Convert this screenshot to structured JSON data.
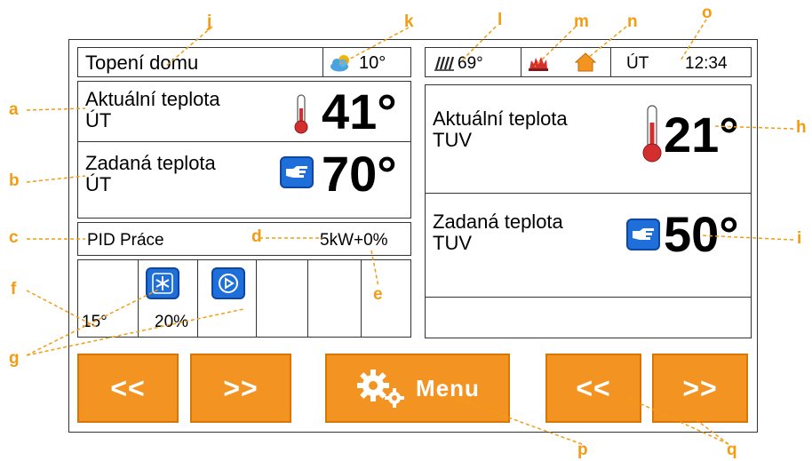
{
  "header": {
    "title": "Topení domu",
    "outdoor_temp": "10°",
    "heat_temp": "69°",
    "day": "ÚT",
    "time": "12:34"
  },
  "heating": {
    "actual_label_1": "Aktuální teplota",
    "actual_label_2": "ÚT",
    "actual_value": "41°",
    "set_label_1": "Zadaná teplota",
    "set_label_2": "ÚT",
    "set_value": "70°"
  },
  "status": {
    "pid_label": "PID Práce",
    "power": "5kW+0%"
  },
  "components": {
    "temp": "15°",
    "fan_value": "20%"
  },
  "hot_water": {
    "actual_label_1": "Aktuální teplota",
    "actual_label_2": "TUV",
    "actual_value": "21°",
    "set_label_1": "Zadaná teplota",
    "set_label_2": "TUV",
    "set_value": "50°"
  },
  "buttons": {
    "prev_left": "<<",
    "next_left": ">>",
    "menu": "Menu",
    "prev_right": "<<",
    "next_right": ">>"
  },
  "callouts": [
    "a",
    "b",
    "c",
    "d",
    "e",
    "f",
    "g",
    "h",
    "i",
    "j",
    "k",
    "l",
    "m",
    "n",
    "o",
    "p",
    "q"
  ],
  "colors": {
    "accent_orange": "#f39422",
    "callout_orange": "#f39c12",
    "icon_blue": "#1e6fd9",
    "thermo_red": "#d32f2f"
  }
}
